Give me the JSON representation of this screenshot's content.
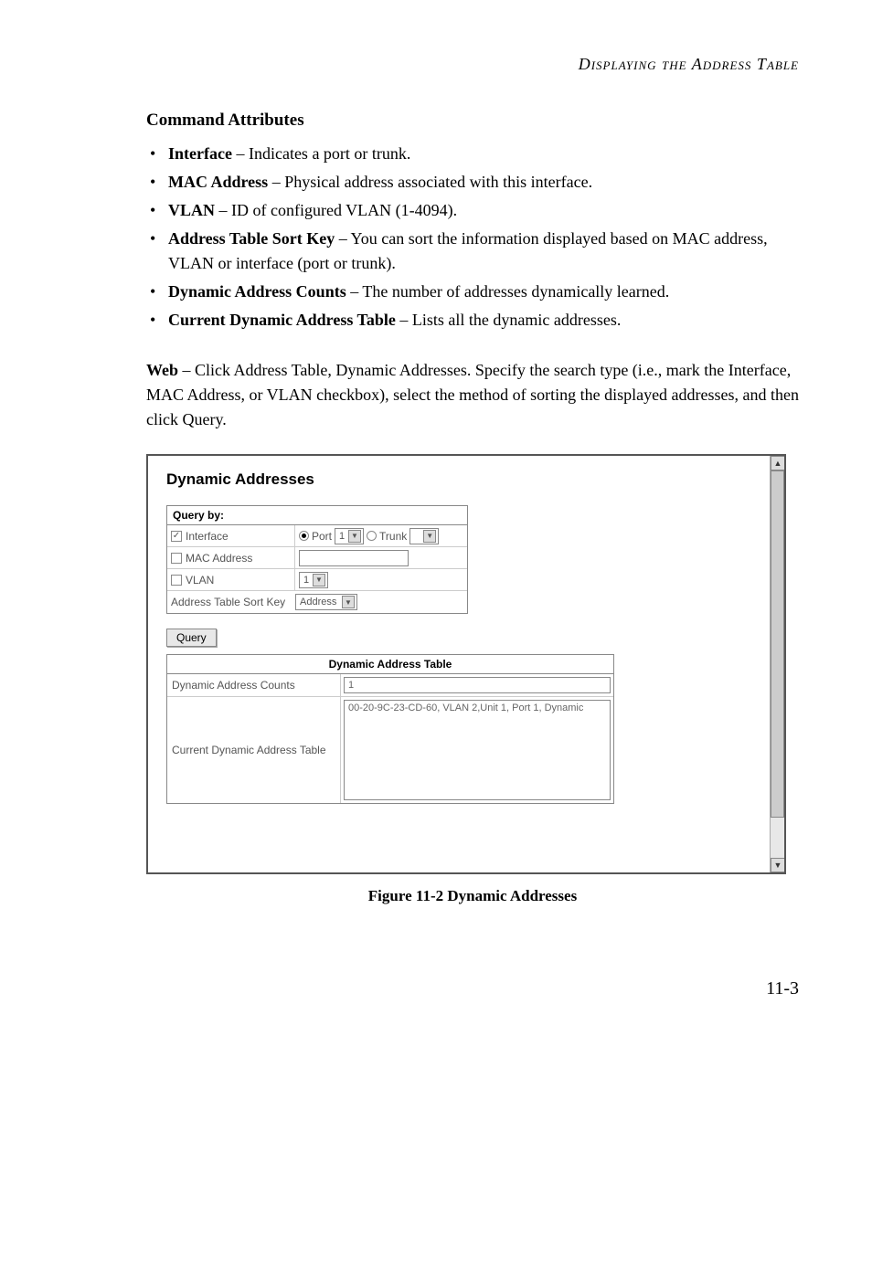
{
  "header": {
    "running_head": "Displaying the Address Table"
  },
  "section": {
    "heading": "Command Attributes"
  },
  "bullets": [
    {
      "term": "Interface",
      "desc": " – Indicates a port or trunk."
    },
    {
      "term": "MAC Address",
      "desc": " – Physical address associated with this interface."
    },
    {
      "term": "VLAN",
      "desc": " – ID of configured VLAN (1-4094)."
    },
    {
      "term": "Address Table Sort Key",
      "desc": " – You can sort the information displayed based on MAC address, VLAN or interface (port or trunk)."
    },
    {
      "term": "Dynamic Address Counts",
      "desc": " – The number of addresses dynamically learned."
    },
    {
      "term": "Current Dynamic Address Table",
      "desc": " – Lists all the dynamic addresses."
    }
  ],
  "para": {
    "lead": "Web",
    "rest": " – Click Address Table, Dynamic Addresses. Specify the search type (i.e., mark the Interface, MAC Address, or VLAN checkbox), select the method of sorting the displayed addresses, and then click Query."
  },
  "panel": {
    "title": "Dynamic Addresses",
    "query_header": "Query by:",
    "rows": {
      "interface": {
        "label": "Interface",
        "checked": true,
        "port_label": "Port",
        "port_value": "1",
        "port_selected": true,
        "trunk_label": "Trunk",
        "trunk_value": "",
        "trunk_selected": false
      },
      "mac": {
        "label": "MAC Address",
        "checked": false
      },
      "vlan": {
        "label": "VLAN",
        "checked": false,
        "value": "1"
      },
      "sort": {
        "label": "Address Table Sort Key",
        "value": "Address"
      }
    },
    "query_button": "Query",
    "result_header": "Dynamic Address Table",
    "counts": {
      "label": "Dynamic Address Counts",
      "value": "1"
    },
    "current": {
      "label": "Current Dynamic Address Table",
      "value": "00-20-9C-23-CD-60, VLAN 2,Unit 1, Port 1, Dynamic"
    }
  },
  "figure": {
    "caption": "Figure 11-2  Dynamic Addresses"
  },
  "page_number": "11-3"
}
